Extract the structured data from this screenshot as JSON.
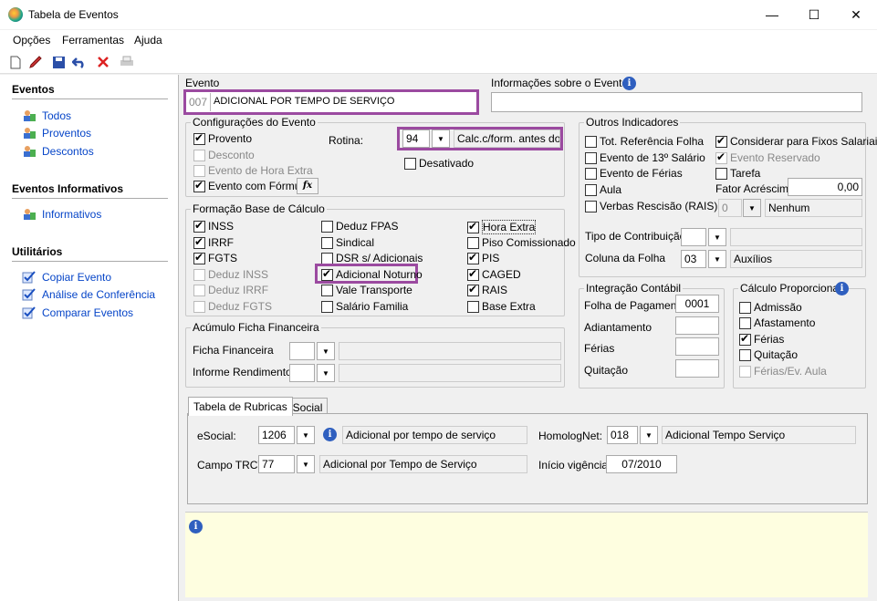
{
  "window": {
    "title": "Tabela de Eventos",
    "minimize": "—",
    "maximize": "☐",
    "close": "✕"
  },
  "menu": [
    "Opções",
    "Ferramentas",
    "Ajuda"
  ],
  "sidebar": {
    "eventos_title": "Eventos",
    "eventos": [
      "Todos",
      "Proventos",
      "Descontos"
    ],
    "informativos_title": "Eventos Informativos",
    "informativos": [
      "Informativos"
    ],
    "utilitarios_title": "Utilitários",
    "utilitarios": [
      "Copiar Evento",
      "Análise de Conferência",
      "Comparar Eventos"
    ]
  },
  "evento": {
    "label": "Evento",
    "code": "007",
    "name": "ADICIONAL POR TEMPO DE SERVIÇO",
    "info_label": "Informações sobre o Evento",
    "info_value": ""
  },
  "config": {
    "title": "Configurações do Evento",
    "provento": "Provento",
    "desconto": "Desconto",
    "hora_extra": "Evento de Hora Extra",
    "formula": "Evento com Fórmula",
    "fx": "fx",
    "rotina_label": "Rotina:",
    "rotina_code": "94",
    "rotina_desc": "Calc.c/form. antes do calc",
    "desativado": "Desativado"
  },
  "base": {
    "title": "Formação Base de Cálculo",
    "col1": [
      {
        "t": "INSS",
        "on": true,
        "dis": false
      },
      {
        "t": "IRRF",
        "on": true,
        "dis": false
      },
      {
        "t": "FGTS",
        "on": true,
        "dis": false
      },
      {
        "t": "Deduz INSS",
        "on": false,
        "dis": true
      },
      {
        "t": "Deduz IRRF",
        "on": false,
        "dis": true
      },
      {
        "t": "Deduz FGTS",
        "on": false,
        "dis": true
      }
    ],
    "col2": [
      {
        "t": "Deduz FPAS",
        "on": false
      },
      {
        "t": "Sindical",
        "on": false
      },
      {
        "t": "DSR s/ Adicionais",
        "on": false
      },
      {
        "t": "Adicional Noturno",
        "on": true
      },
      {
        "t": "Vale Transporte",
        "on": false
      },
      {
        "t": "Salário Familia",
        "on": false
      }
    ],
    "col3": [
      {
        "t": "Hora Extra",
        "on": true
      },
      {
        "t": "Piso Comissionado",
        "on": false
      },
      {
        "t": "PIS",
        "on": true
      },
      {
        "t": "CAGED",
        "on": true
      },
      {
        "t": "RAIS",
        "on": true
      },
      {
        "t": "Base Extra",
        "on": false
      }
    ]
  },
  "acumulo": {
    "title": "Acúmulo Ficha Financeira",
    "ficha": "Ficha Financeira",
    "informe": "Informe Rendimentos"
  },
  "outros": {
    "title": "Outros Indicadores",
    "tot_ref": "Tot. Referência Folha",
    "decimo": "Evento de 13º Salário",
    "ferias": "Evento de Férias",
    "aula": "Aula",
    "verbas": "Verbas Rescisão (RAIS)",
    "verbas_val": "0",
    "verbas_desc": "Nenhum",
    "fixos": "Considerar para Fixos Salariais",
    "reservado": "Evento Reservado",
    "tarefa": "Tarefa",
    "fator_label": "Fator Acréscimo",
    "fator_val": "0,00",
    "tipo_contrib": "Tipo de Contribuição",
    "coluna_folha": "Coluna da Folha",
    "coluna_val": "03",
    "coluna_desc": "Auxílios"
  },
  "integracao": {
    "title": "Integração Contábil",
    "folha": "Folha de Pagamento",
    "folha_val": "0001",
    "adiant": "Adiantamento",
    "ferias": "Férias",
    "quitacao": "Quitação"
  },
  "proporcional": {
    "title": "Cálculo Proporcional",
    "admissao": "Admissão",
    "afastamento": "Afastamento",
    "ferias": "Férias",
    "quitacao": "Quitação",
    "ferias_aula": "Férias/Ev. Aula"
  },
  "tabs": [
    "Tabela de Rubricas",
    "eSocial"
  ],
  "rubricas": {
    "esocial_label": "eSocial:",
    "esocial_code": "1206",
    "esocial_desc": "Adicional por tempo de serviço",
    "homolog_label": "HomologNet:",
    "homolog_code": "018",
    "homolog_desc": "Adicional Tempo Serviço",
    "trct_label": "Campo TRCT:",
    "trct_code": "77",
    "trct_desc": "Adicional por Tempo de Serviço",
    "vigencia_label": "Início vigência:",
    "vigencia_val": "07/2010"
  }
}
